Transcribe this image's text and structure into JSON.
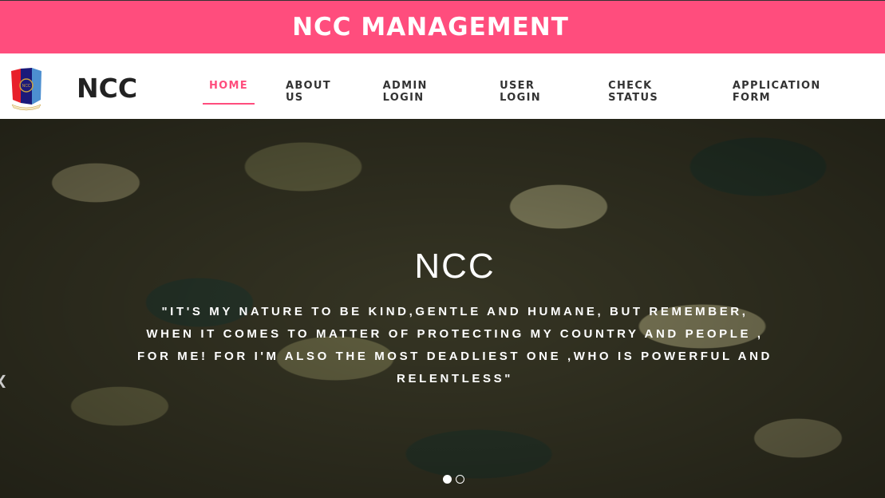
{
  "banner": {
    "title": "NCC MANAGEMENT"
  },
  "header": {
    "logo_text": "NCC",
    "brand": "NCC"
  },
  "nav": {
    "items": [
      {
        "label": "HOME",
        "active": true
      },
      {
        "label": "ABOUT US"
      },
      {
        "label": "ADMIN LOGIN"
      },
      {
        "label": "USER LOGIN"
      },
      {
        "label": "CHECK STATUS"
      },
      {
        "label": "APPLICATION FORM"
      }
    ]
  },
  "hero": {
    "title": "NCC",
    "quote": "\"It's my nature to be kind,gentle and humane, but remember, when it comes to matter of protecting my country and people , for me! for I'm also the most deadliest one ,who is powerful and relentless\"",
    "slides": 2,
    "active_slide": 1,
    "prev_icon": "chevron-left-icon"
  },
  "colors": {
    "accent": "#ff4d7d"
  }
}
